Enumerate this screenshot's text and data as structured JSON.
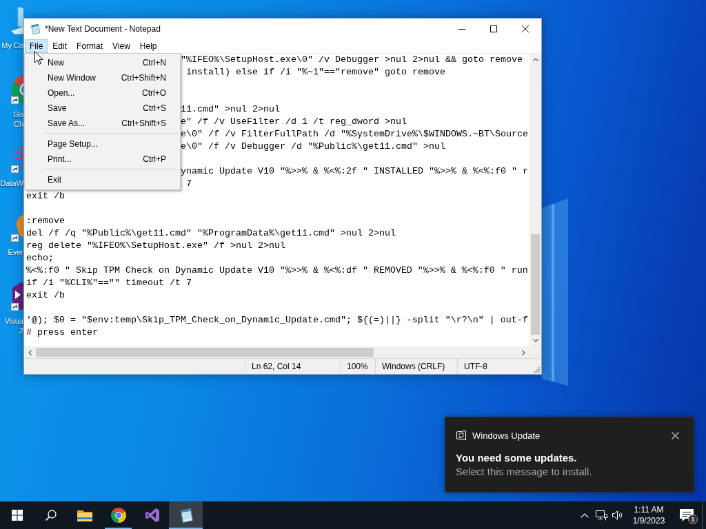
{
  "desktop": {
    "icons": [
      {
        "kind": "computer",
        "label_lines": [
          "My Co"
        ]
      },
      {
        "kind": "browser",
        "label_lines": [
          "Go",
          "Ch"
        ]
      },
      {
        "kind": "data",
        "label_lines": [
          "DataW"
        ]
      },
      {
        "kind": "notes",
        "label_lines": [
          "Ever"
        ]
      },
      {
        "kind": "studio",
        "label_lines": [
          "Visua",
          "2"
        ]
      }
    ]
  },
  "notepad": {
    "title": "*New Text Document - Notepad",
    "menu_bar": [
      {
        "label": "File",
        "selected": true
      },
      {
        "label": "Edit",
        "selected": false
      },
      {
        "label": "Format",
        "selected": false
      },
      {
        "label": "View",
        "selected": false
      },
      {
        "label": "Help",
        "selected": false
      }
    ],
    "file_menu": [
      {
        "kind": "item",
        "label": "New",
        "shortcut": "Ctrl+N"
      },
      {
        "kind": "item",
        "label": "New Window",
        "shortcut": "Ctrl+Shift+N"
      },
      {
        "kind": "item",
        "label": "Open...",
        "shortcut": "Ctrl+O"
      },
      {
        "kind": "item",
        "label": "Save",
        "shortcut": "Ctrl+S"
      },
      {
        "kind": "item",
        "label": "Save As...",
        "shortcut": "Ctrl+Shift+S"
      },
      {
        "kind": "separator"
      },
      {
        "kind": "item",
        "label": "Page Setup..."
      },
      {
        "kind": "item",
        "label": "Print...",
        "shortcut": "Ctrl+P"
      },
      {
        "kind": "separator"
      },
      {
        "kind": "item",
        "label": "Exit"
      }
    ],
    "lines": [
      {
        "kind": "covered",
        "text": "\"%IFEO%\\SetupHost.exe\\0\" /v Debugger >nul 2>nul && goto remove"
      },
      {
        "kind": "covered",
        "text": " install) else if /i \"%~1\"==\"remove\" goto remove"
      },
      {
        "kind": "blank"
      },
      {
        "kind": "blank"
      },
      {
        "kind": "covered",
        "text": "11.cmd\" >nul 2>nul"
      },
      {
        "kind": "covered",
        "text": "e\" /f /v UseFilter /d 1 /t reg_dword >nul"
      },
      {
        "kind": "covered",
        "text": "e\\0\" /f /v FilterFullPath /d \"%SystemDrive%\\$WINDOWS.~BT\\Source"
      },
      {
        "kind": "covered",
        "text": "e\\0\" /f /v Debugger /d \"%Public%\\get11.cmd\" >nul"
      },
      {
        "kind": "blank"
      },
      {
        "kind": "covered",
        "text": "ynamic Update V10 \"%>>% & %<%:2f \" INSTALLED \"%>>% & %<%:f0 \" r"
      },
      {
        "kind": "covered",
        "text": " 7"
      },
      {
        "kind": "full",
        "text": "exit /b"
      },
      {
        "kind": "blank"
      },
      {
        "kind": "full",
        "text": ":remove"
      },
      {
        "kind": "full",
        "text": "del /f /q \"%Public%\\get11.cmd\" \"%ProgramData%\\get11.cmd\" >nul 2>nul"
      },
      {
        "kind": "full",
        "text": "reg delete \"%IFEO%\\SetupHost.exe\" /f >nul 2>nul"
      },
      {
        "kind": "full",
        "text": "echo;"
      },
      {
        "kind": "full",
        "text": "%<%:f0 \" Skip TPM Check on Dynamic Update V10 \"%>>% & %<%:df \" REMOVED \"%>>% & %<%:f0 \" run"
      },
      {
        "kind": "full",
        "text": "if /i \"%CLI%\"==\"\" timeout /t 7"
      },
      {
        "kind": "full",
        "text": "exit /b"
      },
      {
        "kind": "blank"
      },
      {
        "kind": "full",
        "text": "'@); $0 = \"$env:temp\\Skip_TPM_Check_on_Dynamic_Update.cmd\"; ${(=)||} -split \"\\r?\\n\" | out-f"
      },
      {
        "kind": "full",
        "text": "# press enter"
      }
    ],
    "status_bar": {
      "position": "Ln 62, Col 14",
      "zoom": "100%",
      "line_endings": "Windows (CRLF)",
      "encoding": "UTF-8"
    }
  },
  "notification": {
    "app": "Windows Update",
    "title": "You need some updates.",
    "message": "Select this message to install."
  },
  "taskbar": {
    "apps": [
      {
        "kind": "folder",
        "running": false,
        "selected": false
      },
      {
        "kind": "browser",
        "running": true,
        "selected": false
      },
      {
        "kind": "studio",
        "running": false,
        "selected": false
      },
      {
        "kind": "notepad",
        "running": true,
        "selected": true
      }
    ],
    "clock": {
      "time": "1:11 AM",
      "date": "1/9/2023"
    },
    "notification_count": "1"
  }
}
